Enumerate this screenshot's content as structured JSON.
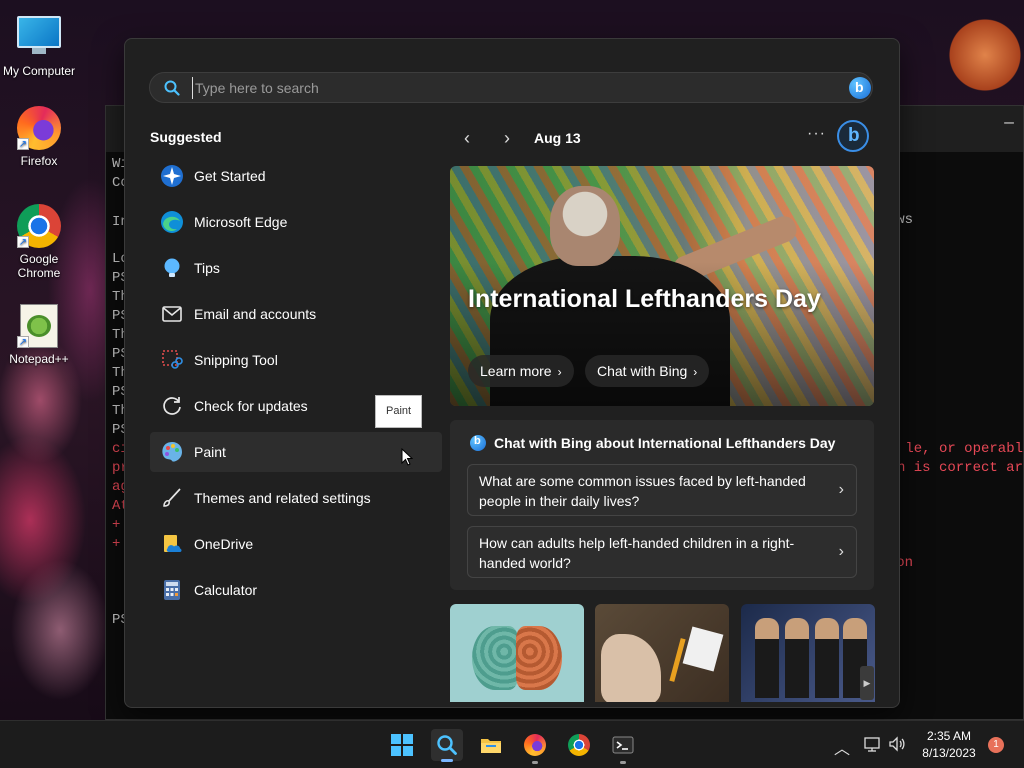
{
  "desktop": {
    "icons": [
      {
        "label": "My Computer"
      },
      {
        "label": "Firefox"
      },
      {
        "label": "Google Chrome"
      },
      {
        "label": "Notepad++"
      }
    ]
  },
  "terminal": {
    "left_fragments": [
      "Wi",
      "Co",
      "In",
      "Lo",
      "PS",
      "Th",
      "PS",
      "Th",
      "PS",
      "Th",
      "PS",
      "Th",
      "PS",
      "ci",
      "pr",
      "ag",
      "At",
      "+",
      "+",
      "PS"
    ],
    "right_fragments": [
      "ws",
      "le, or operabl",
      "n is correct ar",
      "on"
    ]
  },
  "search": {
    "placeholder": "Type here to search"
  },
  "suggested": {
    "title": "Suggested",
    "items": [
      {
        "label": "Get Started",
        "icon": "get-started-icon"
      },
      {
        "label": "Microsoft Edge",
        "icon": "edge-icon"
      },
      {
        "label": "Tips",
        "icon": "lightbulb-icon"
      },
      {
        "label": "Email and accounts",
        "icon": "mail-icon"
      },
      {
        "label": "Snipping Tool",
        "icon": "snipping-tool-icon"
      },
      {
        "label": "Check for updates",
        "icon": "refresh-icon"
      },
      {
        "label": "Paint",
        "icon": "paint-palette-icon"
      },
      {
        "label": "Themes and related settings",
        "icon": "brush-icon"
      },
      {
        "label": "OneDrive",
        "icon": "onedrive-icon"
      },
      {
        "label": "Calculator",
        "icon": "calculator-icon"
      }
    ],
    "tooltip": "Paint"
  },
  "feed": {
    "date": "Aug 13",
    "more": "···",
    "hero": {
      "title": "International Lefthanders Day",
      "learn_more": "Learn more",
      "chat_with_bing": "Chat with Bing"
    },
    "chat": {
      "heading": "Chat with Bing about International Lefthanders Day",
      "questions": [
        "What are some common issues faced by left-handed people in their daily lives?",
        "How can adults help left-handed children in a right-handed world?"
      ]
    }
  },
  "taskbar": {
    "apps": [
      "start",
      "search",
      "file-explorer",
      "firefox",
      "chrome",
      "terminal"
    ],
    "time": "2:35 AM",
    "date": "8/13/2023",
    "notification_count": "1"
  },
  "colors": {
    "accent": "#4cc2ff",
    "panel_bg": "#202020",
    "terminal_error": "#e74856"
  }
}
